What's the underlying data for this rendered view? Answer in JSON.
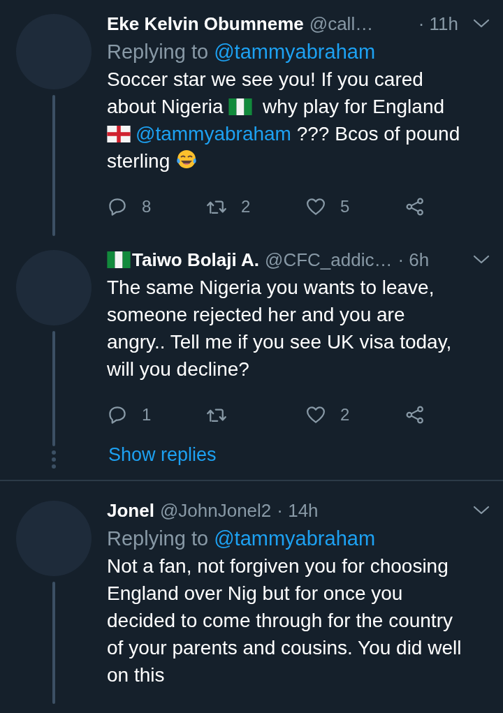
{
  "tweets": [
    {
      "name": "Eke Kelvin Obumneme",
      "handle": "@call…",
      "time": "· 11h",
      "replying_to": {
        "label": "Replying to",
        "mention": "@tammyabraham"
      },
      "body": [
        {
          "kind": "text",
          "text": "Soccer star we see you! If you cared about Nigeria "
        },
        {
          "kind": "ng_flag"
        },
        {
          "kind": "text",
          "text": " why play for England "
        },
        {
          "kind": "england_flag"
        },
        {
          "kind": "mention",
          "text": "@tammyabraham"
        },
        {
          "kind": "text",
          "text": " ??? Bcos of pound sterling "
        },
        {
          "kind": "laughing_emoji"
        }
      ],
      "actions": {
        "replies": "8",
        "retweets": "2",
        "likes": "5"
      },
      "thread_dots": false
    },
    {
      "name": "Taiwo Bolaji A.",
      "name_prefix": {
        "kind": "ng_flag"
      },
      "handle": "@CFC_addic…",
      "time": "· 6h",
      "body": [
        {
          "kind": "text",
          "text": "The same Nigeria you wants to leave, someone rejected her and you are angry..  Tell me if you see UK visa today, will you decline?"
        }
      ],
      "actions": {
        "replies": "1",
        "likes": "2"
      },
      "thread_dots": true,
      "show_replies": "Show replies"
    },
    {
      "name": "Jonel",
      "handle": "@JohnJonel2",
      "time": "· 14h",
      "replying_to": {
        "label": "Replying to",
        "mention": "@tammyabraham"
      },
      "body": [
        {
          "kind": "text",
          "text": "Not a fan, not forgiven you for choosing England over Nig but for once you decided to come through for the country of your parents and cousins. You did well on this"
        }
      ],
      "thread_dots": false
    }
  ]
}
